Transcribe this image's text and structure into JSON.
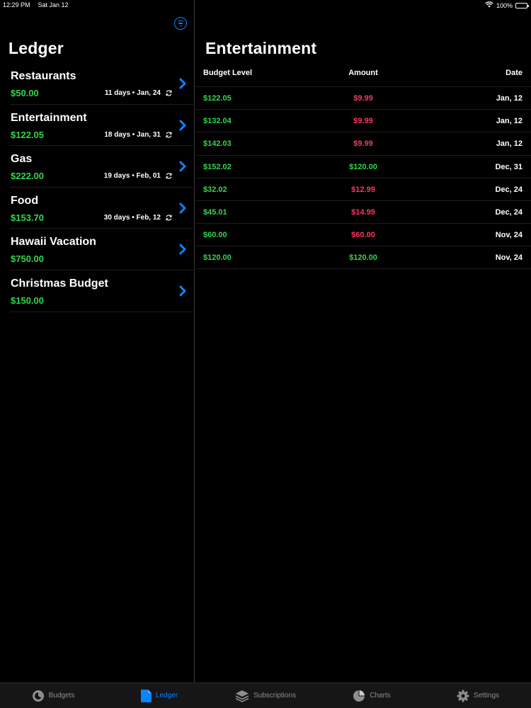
{
  "status_bar": {
    "time": "12:29 PM",
    "date": "Sat Jan 12",
    "battery": "100%",
    "battery_level": 1.0
  },
  "left": {
    "title": "Ledger",
    "items": [
      {
        "name": "Restaurants",
        "amount": "$50.00",
        "meta": "11 days • Jan, 24",
        "recurring": true
      },
      {
        "name": "Entertainment",
        "amount": "$122.05",
        "meta": "18 days • Jan, 31",
        "recurring": true
      },
      {
        "name": "Gas",
        "amount": "$222.00",
        "meta": "19 days • Feb, 01",
        "recurring": true
      },
      {
        "name": "Food",
        "amount": "$153.70",
        "meta": "30 days • Feb, 12",
        "recurring": true
      },
      {
        "name": "Hawaii Vacation",
        "amount": "$750.00",
        "meta": "",
        "recurring": false
      },
      {
        "name": "Christmas Budget",
        "amount": "$150.00",
        "meta": "",
        "recurring": false
      }
    ]
  },
  "detail": {
    "title": "Entertainment",
    "columns": {
      "level": "Budget Level",
      "amount": "Amount",
      "date": "Date"
    },
    "rows": [
      {
        "level": "$122.05",
        "amount": "$9.99",
        "date": "Jan, 12",
        "type": "neg"
      },
      {
        "level": "$132.04",
        "amount": "$9.99",
        "date": "Jan, 12",
        "type": "neg"
      },
      {
        "level": "$142.03",
        "amount": "$9.99",
        "date": "Jan, 12",
        "type": "neg"
      },
      {
        "level": "$152.02",
        "amount": "$120.00",
        "date": "Dec, 31",
        "type": "pos"
      },
      {
        "level": "$32.02",
        "amount": "$12.99",
        "date": "Dec, 24",
        "type": "neg"
      },
      {
        "level": "$45.01",
        "amount": "$14.99",
        "date": "Dec, 24",
        "type": "neg"
      },
      {
        "level": "$60.00",
        "amount": "$60.00",
        "date": "Nov, 24",
        "type": "neg"
      },
      {
        "level": "$120.00",
        "amount": "$120.00",
        "date": "Nov, 24",
        "type": "pos"
      }
    ]
  },
  "tabs": [
    {
      "label": "Budgets",
      "icon": "budgets-icon",
      "active": false
    },
    {
      "label": "Ledger",
      "icon": "ledger-icon",
      "active": true
    },
    {
      "label": "Subscriptions",
      "icon": "subscriptions-icon",
      "active": false
    },
    {
      "label": "Charts",
      "icon": "charts-icon",
      "active": false
    },
    {
      "label": "Settings",
      "icon": "settings-icon",
      "active": false
    }
  ],
  "colors": {
    "accent": "#0a84ff",
    "positive": "#32d74b",
    "negative": "#ff375f"
  }
}
